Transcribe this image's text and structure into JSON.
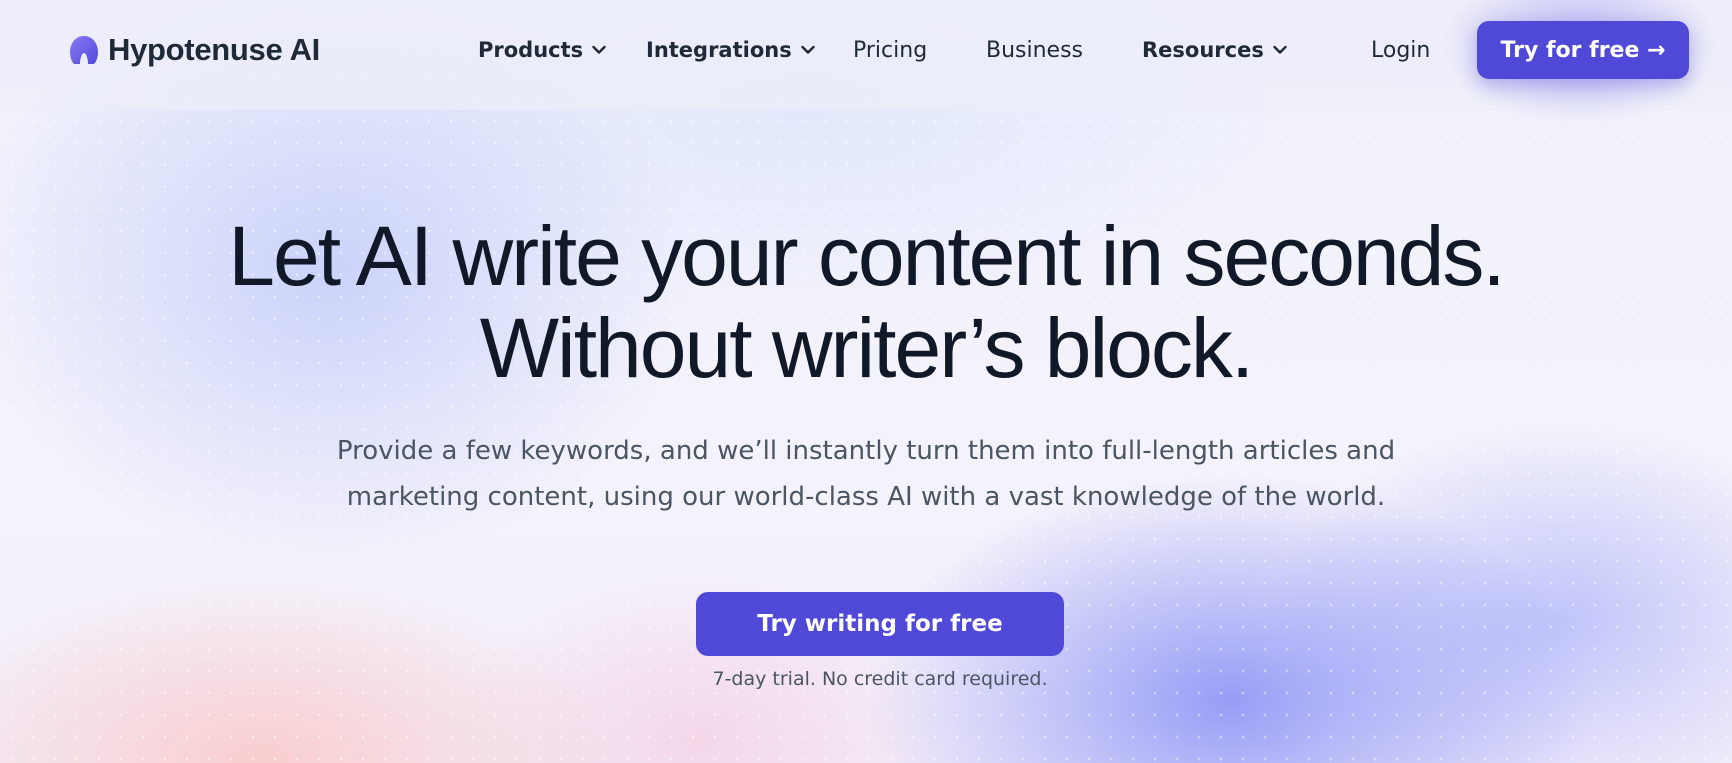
{
  "brand": {
    "name": "Hypotenuse AI",
    "logo_icon": "hypotenuse-logo-icon",
    "accent_color": "#5049d8"
  },
  "nav": {
    "items": [
      {
        "label": "Products",
        "has_dropdown": true
      },
      {
        "label": "Integrations",
        "has_dropdown": true
      },
      {
        "label": "Pricing",
        "has_dropdown": false
      },
      {
        "label": "Business",
        "has_dropdown": false
      },
      {
        "label": "Resources",
        "has_dropdown": true
      }
    ],
    "login_label": "Login",
    "cta_label": "Try for free →"
  },
  "hero": {
    "title_line1": "Let AI write your content in seconds.",
    "title_line2": "Without writer’s block.",
    "subtitle_line1": "Provide a few keywords, and we’ll instantly turn them into full-length articles and",
    "subtitle_line2": "marketing content, using our world-class AI with a vast knowledge of the world.",
    "cta_label": "Try writing for free",
    "cta_note": "7-day trial. No credit card required."
  }
}
